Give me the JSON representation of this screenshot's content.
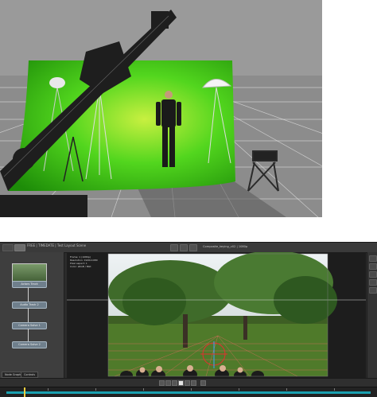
{
  "studio_scene": {
    "screen_color": "#3dd41a",
    "floor_color": "#8c8c8c",
    "sky_color": "#9a9a9a"
  },
  "app": {
    "title": "FREE | TIMEDATE | Test Layout Scene",
    "center_title": "Composite_keying_v02 | 1080p",
    "menu_labels": [
      "File",
      "Node"
    ],
    "nodes": [
      {
        "label": "Actors Track"
      },
      {
        "label": "Audio Track 2"
      },
      {
        "label": "Camera Solve 1"
      },
      {
        "label": "Camera Solve 2"
      }
    ],
    "tabs": [
      "Node Graph",
      "Controls"
    ],
    "viewer_overlay": "Frame: 1 (1080p)\nResolution: 1920x1080\nPixel aspect: 1\nColor: sRGB / 8bit",
    "accent": "#1aa0b0",
    "playhead_color": "#f0d040"
  }
}
